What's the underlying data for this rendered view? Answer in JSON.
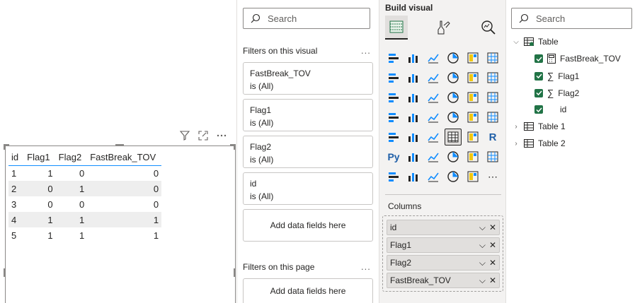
{
  "canvas": {
    "visual_header_icons": [
      "filter-icon",
      "focus-mode-icon",
      "more-options-icon"
    ],
    "table": {
      "columns": [
        "id",
        "Flag1",
        "Flag2",
        "FastBreak_TOV"
      ],
      "rows": [
        [
          "1",
          "1",
          "0",
          "0"
        ],
        [
          "2",
          "0",
          "1",
          "0"
        ],
        [
          "3",
          "0",
          "0",
          "0"
        ],
        [
          "4",
          "1",
          "1",
          "1"
        ],
        [
          "5",
          "1",
          "1",
          "1"
        ]
      ]
    }
  },
  "filters": {
    "search_placeholder": "Search",
    "on_visual_title": "Filters on this visual",
    "ellipsis": "...",
    "cards": [
      {
        "field": "FastBreak_TOV",
        "state": "is (All)"
      },
      {
        "field": "Flag1",
        "state": "is (All)"
      },
      {
        "field": "Flag2",
        "state": "is (All)"
      },
      {
        "field": "id",
        "state": "is (All)"
      }
    ],
    "add_fields_label": "Add data fields here",
    "on_page_title": "Filters on this page",
    "add_fields_label_page": "Add data fields here"
  },
  "build": {
    "title": "Build visual",
    "columns_title": "Columns",
    "fields": [
      "id",
      "Flag1",
      "Flag2",
      "FastBreak_TOV"
    ],
    "accent": "#217346"
  },
  "data_pane": {
    "search_placeholder": "Search",
    "table_name": "Table",
    "fields": [
      "FastBreak_TOV",
      "Flag1",
      "Flag2",
      "id"
    ],
    "other_tables": [
      "Table 1",
      "Table 2"
    ]
  }
}
